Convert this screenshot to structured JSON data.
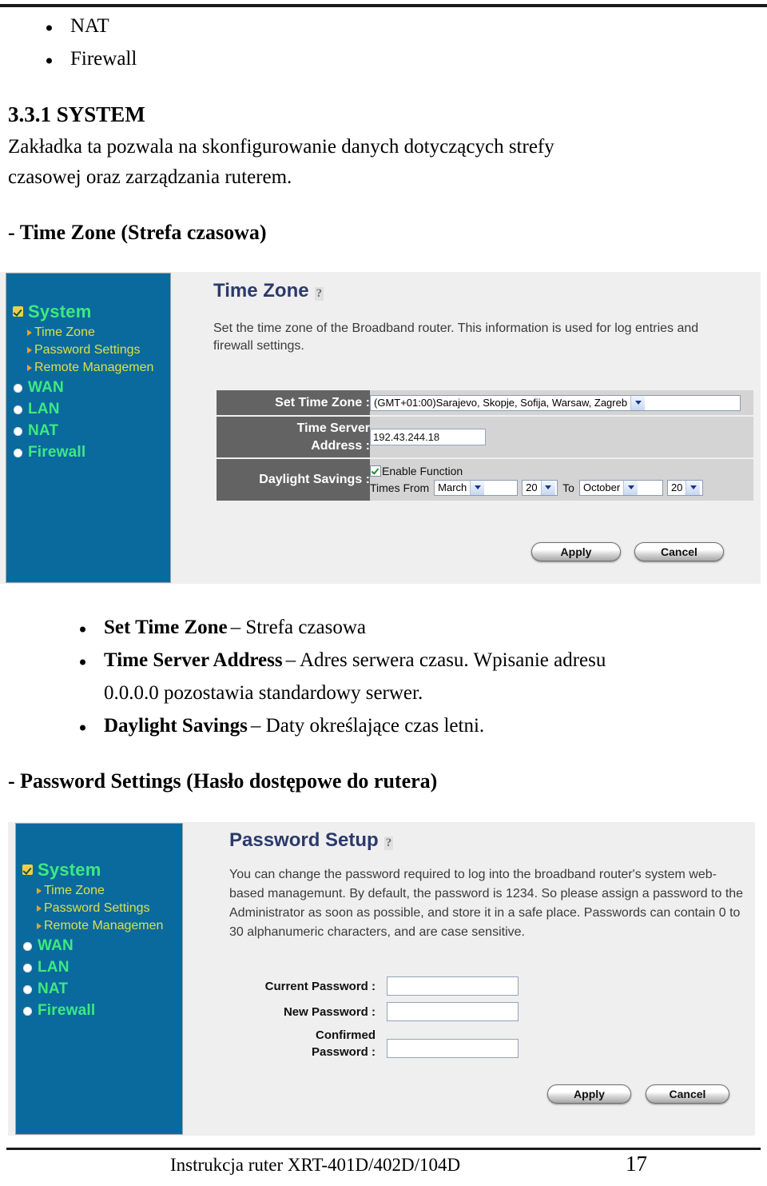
{
  "document": {
    "top_bullets": [
      "NAT",
      "Firewall"
    ],
    "section_number": "3.3.1 SYSTEM",
    "section_intro_line1": "Zakładka ta pozwala na skonfigurowanie danych dotyczących strefy",
    "section_intro_line2": "czasowej oraz zarządzania ruterem.",
    "heading_timezone": "- Time Zone (Strefa czasowa)",
    "heading_password": "- Password Settings (Hasło dostępowe do rutera)",
    "mid_bullets": [
      {
        "term": "Set Time Zone",
        "desc": "– Strefa czasowa",
        "desc2": ""
      },
      {
        "term": "Time Server Address",
        "desc": "– Adres serwera czasu. Wpisanie adresu",
        "desc2": "0.0.0.0 pozostawia standardowy serwer."
      },
      {
        "term": "Daylight Savings",
        "desc": "– Daty określające czas letni.",
        "desc2": ""
      }
    ],
    "footer_text": "Instrukcja ruter XRT-401D/402D/104D",
    "footer_page": "17"
  },
  "router_nav": {
    "main_items": [
      {
        "label": "System",
        "marker": "check-marker"
      },
      {
        "label": "WAN",
        "marker": "radio-marker"
      },
      {
        "label": "LAN",
        "marker": "radio-marker"
      },
      {
        "label": "NAT",
        "marker": "radio-marker"
      },
      {
        "label": "Firewall",
        "marker": "radio-marker"
      }
    ],
    "sub_items": [
      "Time Zone",
      "Password Settings",
      "Remote Managemen"
    ]
  },
  "timezone_panel": {
    "title": "Time Zone",
    "help_icon": "help-icon",
    "description": "Set the time zone of the Broadband router. This information is used for log entries and firewall settings.",
    "rows": {
      "set_time_zone_label": "Set Time Zone :",
      "set_time_zone_value": "(GMT+01:00)Sarajevo, Skopje, Sofija, Warsaw, Zagreb",
      "time_server_label_line1": "Time Server",
      "time_server_label_line2": "Address :",
      "time_server_value": "192.43.244.18",
      "daylight_label": "Daylight Savings :",
      "enable_function_label": "Enable Function",
      "enable_function_checked": true,
      "times_from_label": "Times From",
      "from_month": "March",
      "from_day": "20",
      "to_label": "To",
      "to_month": "October",
      "to_day": "20"
    },
    "buttons": {
      "apply": "Apply",
      "cancel": "Cancel"
    }
  },
  "password_panel": {
    "title": "Password Setup",
    "help_icon": "help-icon",
    "description": "You can change the password required to log into the broadband router's system web-based managemunt. By default, the password is 1234. So please assign a password to the Administrator as soon as possible, and store it in a safe place. Passwords can contain 0 to 30 alphanumeric characters, and are case sensitive.",
    "fields": [
      {
        "label": "Current Password :",
        "label2": "",
        "value": ""
      },
      {
        "label": "New Password :",
        "label2": "",
        "value": ""
      },
      {
        "label": "Confirmed",
        "label2": "Password :",
        "value": ""
      }
    ],
    "buttons": {
      "apply": "Apply",
      "cancel": "Cancel"
    }
  },
  "colors": {
    "nav_blue": "#0a6a9e",
    "nav_green": "#3dea7e",
    "nav_yellow": "#d9e04b",
    "panel_bg": "#efefef",
    "label_gray": "#636363",
    "title_navy": "#2b3a6b"
  }
}
